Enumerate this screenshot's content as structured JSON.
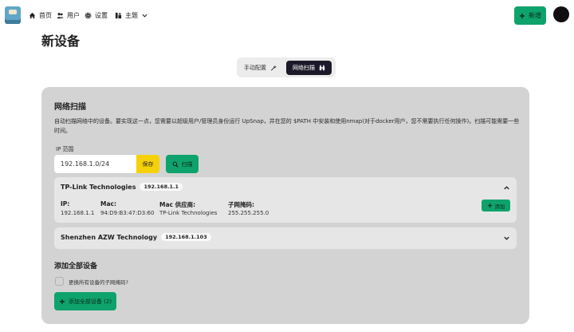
{
  "nav": {
    "items": [
      {
        "label": "首页",
        "icon": "home-icon"
      },
      {
        "label": "用户",
        "icon": "users-icon"
      },
      {
        "label": "设置",
        "icon": "gear-icon"
      },
      {
        "label": "主题",
        "icon": "theme-icon"
      }
    ],
    "new_button_label": "新增"
  },
  "page": {
    "title": "新设备"
  },
  "mode_switch": {
    "manual_label": "手动配置",
    "scan_label": "网络扫描",
    "selected": "scan_label"
  },
  "scan": {
    "title": "网络扫描",
    "description": "自动扫描网络中的设备。要实现这一点，您需要以超级用户/管理员身份运行 UpSnap，并在您的 $PATH 中安装和使用nmap(对于docker用户，您不需要执行任何操作)。扫描可能需要一些时间。",
    "ip_range_label": "IP 范围",
    "ip_range_value": "192.168.1.0/24",
    "save_label": "保存",
    "scan_label": "扫描"
  },
  "devices": [
    {
      "name": "TP-Link Technologies",
      "ip_badge": "192.168.1.1",
      "expanded": true,
      "fields": {
        "ip_label": "IP:",
        "ip_value": "192.168.1.1",
        "mac_label": "Mac:",
        "mac_value": "94:D9:B3:47:D3:60",
        "vendor_label": "Mac 供应商:",
        "vendor_value": "TP-Link Technologies",
        "netmask_label": "子网掩码:",
        "netmask_value": "255.255.255.0"
      },
      "add_label": "添加"
    },
    {
      "name": "Shenzhen AZW Technology",
      "ip_badge": "192.168.1.103",
      "expanded": false
    }
  ],
  "add_all": {
    "title": "添加全部设备",
    "replace_netmask_label": "更换所有设备的子网掩码?",
    "replace_netmask_checked": false,
    "button_label": "添加全部设备 (2)"
  },
  "colors": {
    "accent_green": "#0ea36c",
    "save_yellow": "#f5d10a",
    "card_bg": "#d3d3d3",
    "dark": "#1c1a2a"
  }
}
